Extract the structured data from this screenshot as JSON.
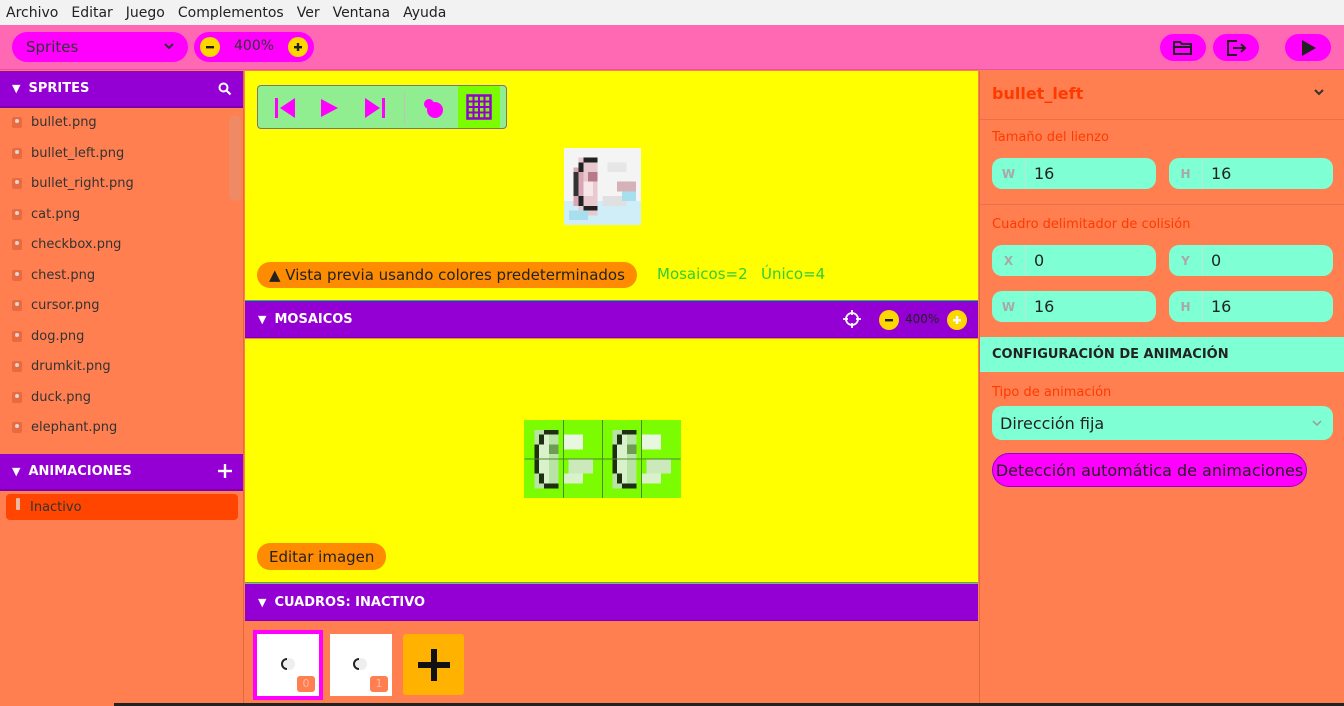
{
  "menubar": {
    "items": [
      "Archivo",
      "Editar",
      "Juego",
      "Complementos",
      "Ver",
      "Ventana",
      "Ayuda"
    ]
  },
  "toolbar": {
    "section_select": "Sprites",
    "zoom": "400%",
    "right_icons": [
      "folder-open-icon",
      "export-icon",
      "play-icon"
    ]
  },
  "sprites": {
    "header": "SPRITES",
    "items": [
      "bullet.png",
      "bullet_left.png",
      "bullet_right.png",
      "cat.png",
      "checkbox.png",
      "chest.png",
      "cursor.png",
      "dog.png",
      "drumkit.png",
      "duck.png",
      "elephant.png"
    ]
  },
  "animations": {
    "header": "ANIMACIONES",
    "items": [
      "Inactivo"
    ]
  },
  "preview": {
    "warning": "▲ Vista previa usando colores predeterminados",
    "tiles_count": "Mosaicos=2",
    "unique_count": "Único=4"
  },
  "mosaicos": {
    "header": "MOSAICOS",
    "zoom": "400%",
    "edit_button": "Editar imagen"
  },
  "frames": {
    "header": "CUADROS: INACTIVO",
    "items": [
      "0",
      "1"
    ]
  },
  "properties": {
    "sprite_name": "bullet_left",
    "canvas_label": "Tamaño del lienzo",
    "canvas": {
      "w_label": "W",
      "w": "16",
      "h_label": "H",
      "h": "16"
    },
    "collision_label": "Cuadro delimitador de colisión",
    "collision": {
      "x_label": "X",
      "x": "0",
      "y_label": "Y",
      "y": "0",
      "w_label": "W",
      "w": "16",
      "h_label": "H",
      "h": "16"
    },
    "anim_config_header": "CONFIGURACIÓN DE ANIMACIÓN",
    "anim_type_label": "Tipo de animación",
    "anim_type": "Dirección fija",
    "auto_detect_button": "Detección automática de animaciones"
  },
  "colors": {
    "toolbar": "#ff69b4",
    "panel": "#ff7f50",
    "header": "#9400d3",
    "canvas": "#ffff00",
    "field": "#7fffd4",
    "accent": "#ff00ff"
  }
}
